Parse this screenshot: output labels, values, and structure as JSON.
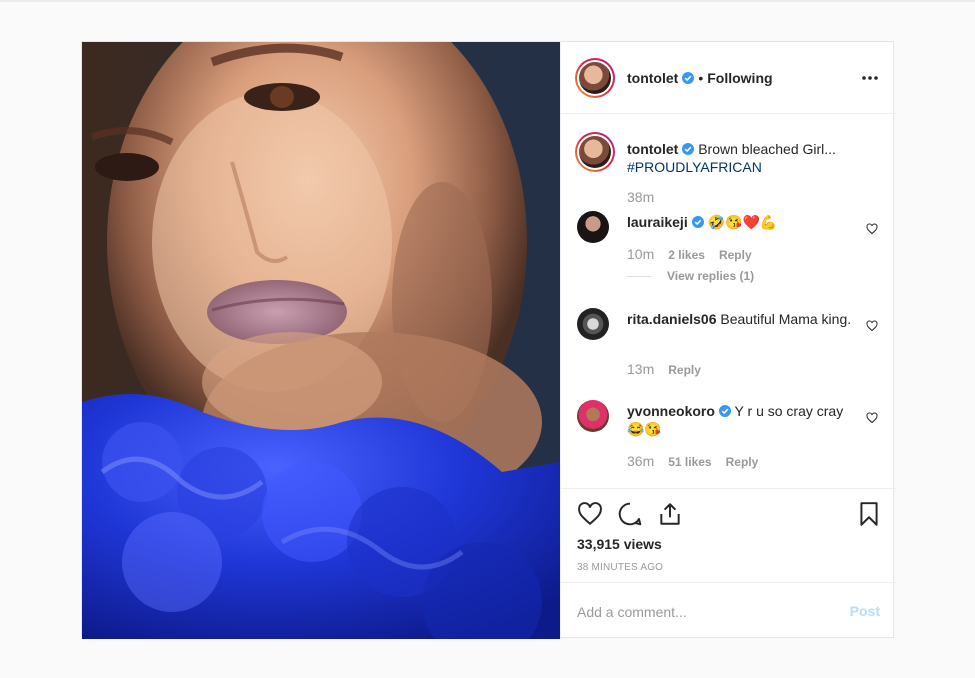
{
  "colors": {
    "verified": "#3897f0",
    "hashtag": "#003569",
    "post_disabled": "#b2dffc",
    "muted": "#999999"
  },
  "header": {
    "username": "tontolet",
    "separator": "•",
    "follow_status": "Following",
    "more_icon": "more-horizontal-icon"
  },
  "caption": {
    "username": "tontolet",
    "text": "Brown bleached Girl...",
    "hashtag": "#PROUDLYAFRICAN",
    "time": "38m"
  },
  "comments": [
    {
      "username": "lauraikeji",
      "verified": true,
      "text": "🤣😘❤️💪",
      "time": "10m",
      "likes": "2 likes",
      "reply": "Reply",
      "view_replies": "View replies (1)"
    },
    {
      "username": "rita.daniels06",
      "verified": false,
      "text": "Beautiful Mama king.",
      "time": "13m",
      "likes": "",
      "reply": "Reply"
    },
    {
      "username": "yvonneokoro",
      "verified": true,
      "text": "Y r u so cray cray 😂😘",
      "time": "36m",
      "likes": "51 likes",
      "reply": "Reply"
    }
  ],
  "actions": {
    "like_icon": "heart-icon",
    "comment_icon": "comment-icon",
    "share_icon": "share-icon",
    "save_icon": "bookmark-icon",
    "views": "33,915 views",
    "time_ago": "38 MINUTES AGO"
  },
  "add_comment": {
    "placeholder": "Add a comment...",
    "post_label": "Post"
  }
}
